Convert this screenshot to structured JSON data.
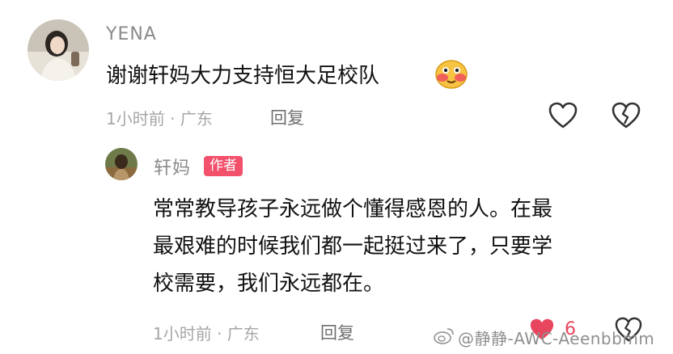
{
  "comment": {
    "username": "YENA",
    "text": "谢谢轩妈大力支持恒大足校队",
    "emoji": "face-emoji",
    "meta": "1小时前 · 广东",
    "reply_label": "回复",
    "like_icon": "heart-outline-icon",
    "dislike_icon": "broken-heart-icon"
  },
  "reply": {
    "username": "轩妈",
    "badge": "作者",
    "text_lines": [
      "常常教导孩子永远做个懂得感恩的人。在最",
      "最艰难的时候我们都一起挺过来了，只要学",
      "校需要，我们永远都在。"
    ],
    "meta": "1小时前 · 广东",
    "reply_label": "回复",
    "like_count": "6",
    "like_icon": "heart-filled-icon",
    "dislike_icon": "broken-heart-icon"
  },
  "watermark": {
    "text": "@静静-AWC-Aeenbbmm",
    "icon": "weibo-icon"
  },
  "colors": {
    "badge": "#f2506b",
    "liked_heart": "#e8455e",
    "meta_text": "#a6a6a6"
  }
}
